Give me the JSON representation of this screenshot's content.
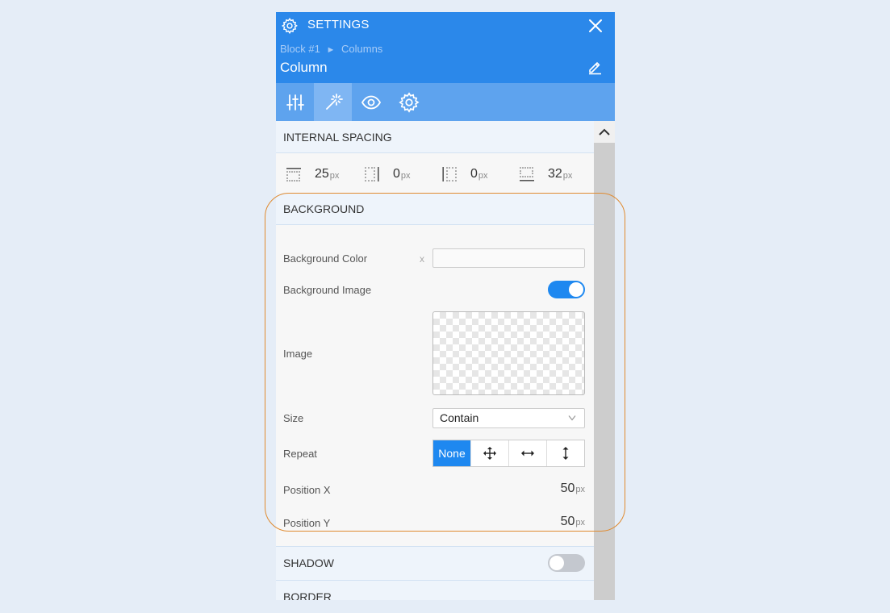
{
  "header": {
    "title": "SETTINGS",
    "breadcrumb": [
      "Block #1",
      "►",
      "Columns"
    ],
    "subtitle": "Column"
  },
  "tabs": [
    {
      "icon": "sliders-icon",
      "active": false
    },
    {
      "icon": "magic-wand-icon",
      "active": true
    },
    {
      "icon": "eye-icon",
      "active": false
    },
    {
      "icon": "gear-icon",
      "active": false
    }
  ],
  "internal_spacing": {
    "title": "INTERNAL SPACING",
    "values": [
      {
        "icon": "padding-top-icon",
        "value": "25",
        "unit": "px"
      },
      {
        "icon": "padding-right-icon",
        "value": "0",
        "unit": "px"
      },
      {
        "icon": "padding-left-icon",
        "value": "0",
        "unit": "px"
      },
      {
        "icon": "padding-bottom-icon",
        "value": "32",
        "unit": "px"
      }
    ]
  },
  "background": {
    "title": "BACKGROUND",
    "color_label": "Background Color",
    "color_clear": "x",
    "color_value": "",
    "image_toggle_label": "Background Image",
    "image_toggle_on": true,
    "image_label": "Image",
    "size_label": "Size",
    "size_value": "Contain",
    "repeat_label": "Repeat",
    "repeat_options": [
      {
        "text": "None",
        "icon": "",
        "active": true
      },
      {
        "text": "",
        "icon": "move-icon",
        "active": false
      },
      {
        "text": "",
        "icon": "arrows-horizontal-icon",
        "active": false
      },
      {
        "text": "",
        "icon": "arrows-vertical-icon",
        "active": false
      }
    ],
    "position_x_label": "Position X",
    "position_x_value": "50",
    "position_y_label": "Position Y",
    "position_y_value": "50",
    "unit": "px"
  },
  "shadow": {
    "title": "SHADOW",
    "toggle_on": false
  },
  "border": {
    "title": "BORDER"
  },
  "colors": {
    "header": "#2b88ea",
    "accent": "#1e88f0",
    "highlight": "#e08a2f"
  }
}
